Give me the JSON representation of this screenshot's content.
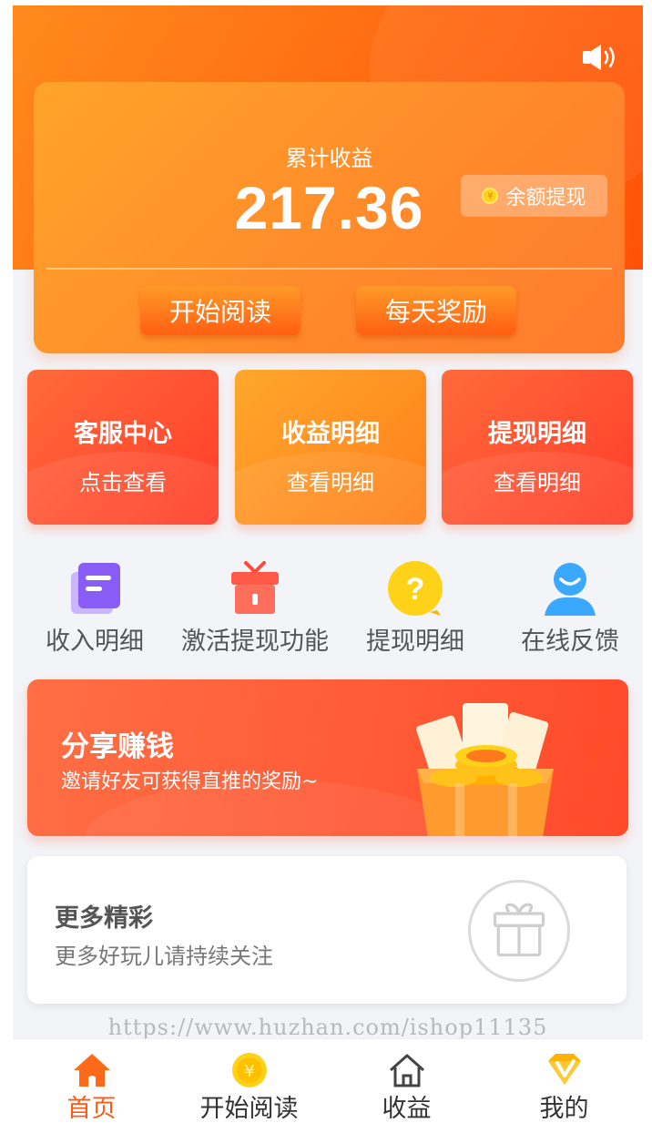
{
  "colors": {
    "accent": "#ff6a12",
    "accent_light": "#ffa42a",
    "red": "#ff4a2a",
    "nav_active": "#ff5a14"
  },
  "header": {
    "sound_icon": "speaker-icon"
  },
  "earnings": {
    "label": "累计收益",
    "amount": "217.36",
    "withdraw_label": "余额提现",
    "start_reading_label": "开始阅读",
    "daily_reward_label": "每天奖励"
  },
  "tiles": [
    {
      "title": "客服中心",
      "subtitle": "点击查看"
    },
    {
      "title": "收益明细",
      "subtitle": "查看明细"
    },
    {
      "title": "提现明细",
      "subtitle": "查看明细"
    }
  ],
  "shortcuts": [
    {
      "label": "收入明细",
      "icon": "document-icon"
    },
    {
      "label": "激活提现功能",
      "icon": "gift-box-icon"
    },
    {
      "label": "提现明细",
      "icon": "question-bubble-icon"
    },
    {
      "label": "在线反馈",
      "icon": "user-icon"
    }
  ],
  "share_banner": {
    "title": "分享赚钱",
    "subtitle": "邀请好友可获得直推的奖励~"
  },
  "more": {
    "title": "更多精彩",
    "subtitle": "更多好玩儿请持续关注"
  },
  "watermark": "https://www.huzhan.com/ishop11135",
  "bottom_nav": [
    {
      "label": "首页",
      "icon": "home-icon",
      "active": true
    },
    {
      "label": "开始阅读",
      "icon": "coin-icon",
      "active": false
    },
    {
      "label": "收益",
      "icon": "house-outline-icon",
      "active": false
    },
    {
      "label": "我的",
      "icon": "vip-diamond-icon",
      "active": false
    }
  ]
}
